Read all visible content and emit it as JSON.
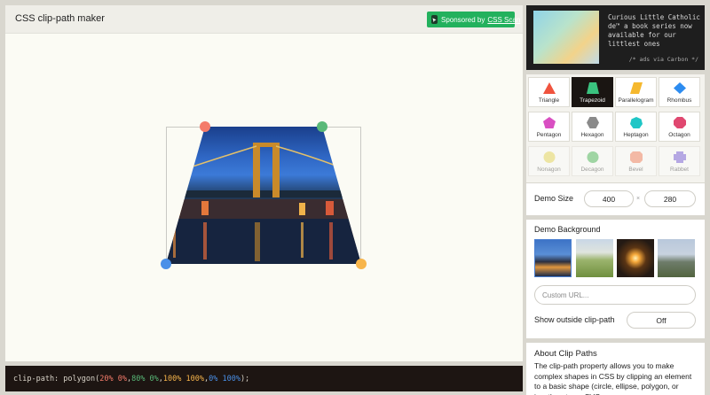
{
  "app": {
    "title": "CSS clip-path maker",
    "sponsor_prefix": "Sponsored by",
    "sponsor_link": "CSS Scan"
  },
  "code": {
    "prefix": "clip-path: polygon(",
    "p1": "20% 0%",
    "p2": "80% 0%",
    "p3": "100% 100%",
    "p4": "0% 100%",
    "sep": ", ",
    "suffix": ");"
  },
  "ad": {
    "text": "Curious Little Catholic de™ a book series now available for our littlest ones",
    "via": "/* ads via Carbon */"
  },
  "shapes": [
    {
      "label": "Triangle",
      "icon": "triangle-icon",
      "color": "#f0533e"
    },
    {
      "label": "Trapezoid",
      "icon": "trapezoid-icon",
      "color": "#3ac27f"
    },
    {
      "label": "Parallelogram",
      "icon": "parallelogram-icon",
      "color": "#f5b82e"
    },
    {
      "label": "Rhombus",
      "icon": "rhombus-icon",
      "color": "#2d8cf0"
    },
    {
      "label": "Pentagon",
      "icon": "pentagon-icon",
      "color": "#d94fc2"
    },
    {
      "label": "Hexagon",
      "icon": "hexagon-icon",
      "color": "#8a8a8a"
    },
    {
      "label": "Heptagon",
      "icon": "heptagon-icon",
      "color": "#1fc6c6"
    },
    {
      "label": "Octagon",
      "icon": "octagon-icon",
      "color": "#e04870"
    },
    {
      "label": "Nonagon",
      "icon": "nonagon-icon",
      "color": "#e6d64a"
    },
    {
      "label": "Decagon",
      "icon": "decagon-icon",
      "color": "#3ab24a"
    },
    {
      "label": "Bevel",
      "icon": "bevel-icon",
      "color": "#f2734d"
    },
    {
      "label": "Rabbet",
      "icon": "rabbet-icon",
      "color": "#6a4fd6"
    }
  ],
  "demo_size": {
    "label": "Demo Size",
    "width": "400",
    "times": "×",
    "height": "280"
  },
  "demo_background": {
    "label": "Demo Background",
    "url_placeholder": "Custom URL...",
    "outside_label": "Show outside clip-path",
    "outside_value": "Off"
  },
  "about": {
    "title": "About Clip Paths",
    "body": "The clip-path property allows you to make complex shapes in CSS by clipping an element to a basic shape (circle, ellipse, polygon, or inset), or to an SVG"
  }
}
